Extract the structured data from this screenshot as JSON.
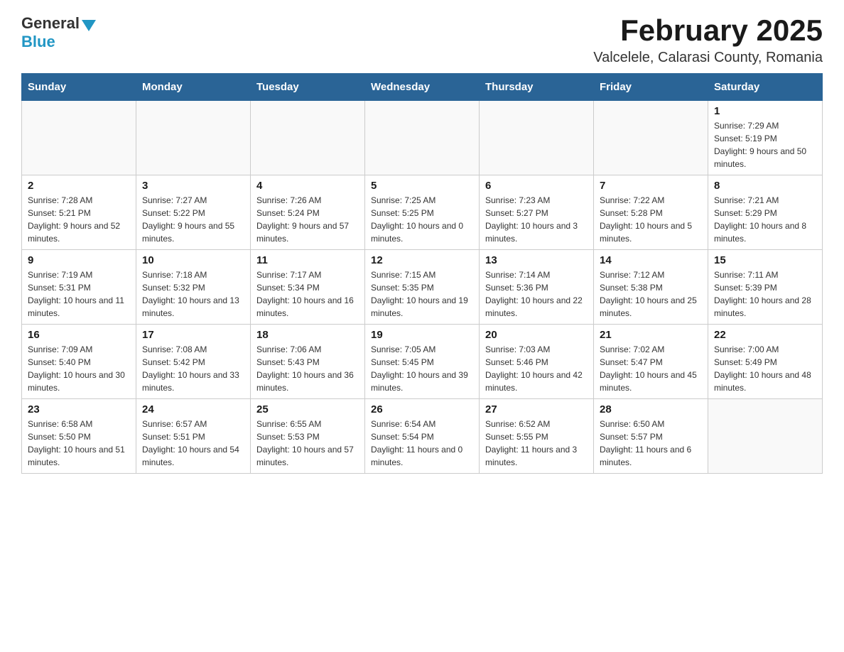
{
  "header": {
    "logo_general": "General",
    "logo_blue": "Blue",
    "title": "February 2025",
    "subtitle": "Valcelele, Calarasi County, Romania"
  },
  "calendar": {
    "days_of_week": [
      "Sunday",
      "Monday",
      "Tuesday",
      "Wednesday",
      "Thursday",
      "Friday",
      "Saturday"
    ],
    "weeks": [
      [
        {
          "day": "",
          "info": ""
        },
        {
          "day": "",
          "info": ""
        },
        {
          "day": "",
          "info": ""
        },
        {
          "day": "",
          "info": ""
        },
        {
          "day": "",
          "info": ""
        },
        {
          "day": "",
          "info": ""
        },
        {
          "day": "1",
          "info": "Sunrise: 7:29 AM\nSunset: 5:19 PM\nDaylight: 9 hours and 50 minutes."
        }
      ],
      [
        {
          "day": "2",
          "info": "Sunrise: 7:28 AM\nSunset: 5:21 PM\nDaylight: 9 hours and 52 minutes."
        },
        {
          "day": "3",
          "info": "Sunrise: 7:27 AM\nSunset: 5:22 PM\nDaylight: 9 hours and 55 minutes."
        },
        {
          "day": "4",
          "info": "Sunrise: 7:26 AM\nSunset: 5:24 PM\nDaylight: 9 hours and 57 minutes."
        },
        {
          "day": "5",
          "info": "Sunrise: 7:25 AM\nSunset: 5:25 PM\nDaylight: 10 hours and 0 minutes."
        },
        {
          "day": "6",
          "info": "Sunrise: 7:23 AM\nSunset: 5:27 PM\nDaylight: 10 hours and 3 minutes."
        },
        {
          "day": "7",
          "info": "Sunrise: 7:22 AM\nSunset: 5:28 PM\nDaylight: 10 hours and 5 minutes."
        },
        {
          "day": "8",
          "info": "Sunrise: 7:21 AM\nSunset: 5:29 PM\nDaylight: 10 hours and 8 minutes."
        }
      ],
      [
        {
          "day": "9",
          "info": "Sunrise: 7:19 AM\nSunset: 5:31 PM\nDaylight: 10 hours and 11 minutes."
        },
        {
          "day": "10",
          "info": "Sunrise: 7:18 AM\nSunset: 5:32 PM\nDaylight: 10 hours and 13 minutes."
        },
        {
          "day": "11",
          "info": "Sunrise: 7:17 AM\nSunset: 5:34 PM\nDaylight: 10 hours and 16 minutes."
        },
        {
          "day": "12",
          "info": "Sunrise: 7:15 AM\nSunset: 5:35 PM\nDaylight: 10 hours and 19 minutes."
        },
        {
          "day": "13",
          "info": "Sunrise: 7:14 AM\nSunset: 5:36 PM\nDaylight: 10 hours and 22 minutes."
        },
        {
          "day": "14",
          "info": "Sunrise: 7:12 AM\nSunset: 5:38 PM\nDaylight: 10 hours and 25 minutes."
        },
        {
          "day": "15",
          "info": "Sunrise: 7:11 AM\nSunset: 5:39 PM\nDaylight: 10 hours and 28 minutes."
        }
      ],
      [
        {
          "day": "16",
          "info": "Sunrise: 7:09 AM\nSunset: 5:40 PM\nDaylight: 10 hours and 30 minutes."
        },
        {
          "day": "17",
          "info": "Sunrise: 7:08 AM\nSunset: 5:42 PM\nDaylight: 10 hours and 33 minutes."
        },
        {
          "day": "18",
          "info": "Sunrise: 7:06 AM\nSunset: 5:43 PM\nDaylight: 10 hours and 36 minutes."
        },
        {
          "day": "19",
          "info": "Sunrise: 7:05 AM\nSunset: 5:45 PM\nDaylight: 10 hours and 39 minutes."
        },
        {
          "day": "20",
          "info": "Sunrise: 7:03 AM\nSunset: 5:46 PM\nDaylight: 10 hours and 42 minutes."
        },
        {
          "day": "21",
          "info": "Sunrise: 7:02 AM\nSunset: 5:47 PM\nDaylight: 10 hours and 45 minutes."
        },
        {
          "day": "22",
          "info": "Sunrise: 7:00 AM\nSunset: 5:49 PM\nDaylight: 10 hours and 48 minutes."
        }
      ],
      [
        {
          "day": "23",
          "info": "Sunrise: 6:58 AM\nSunset: 5:50 PM\nDaylight: 10 hours and 51 minutes."
        },
        {
          "day": "24",
          "info": "Sunrise: 6:57 AM\nSunset: 5:51 PM\nDaylight: 10 hours and 54 minutes."
        },
        {
          "day": "25",
          "info": "Sunrise: 6:55 AM\nSunset: 5:53 PM\nDaylight: 10 hours and 57 minutes."
        },
        {
          "day": "26",
          "info": "Sunrise: 6:54 AM\nSunset: 5:54 PM\nDaylight: 11 hours and 0 minutes."
        },
        {
          "day": "27",
          "info": "Sunrise: 6:52 AM\nSunset: 5:55 PM\nDaylight: 11 hours and 3 minutes."
        },
        {
          "day": "28",
          "info": "Sunrise: 6:50 AM\nSunset: 5:57 PM\nDaylight: 11 hours and 6 minutes."
        },
        {
          "day": "",
          "info": ""
        }
      ]
    ]
  }
}
